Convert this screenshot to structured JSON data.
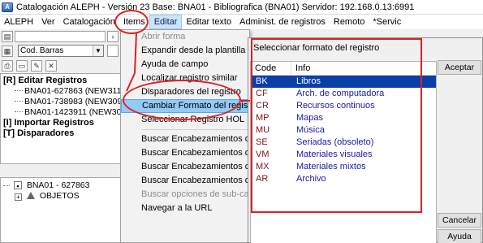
{
  "window": {
    "title": "Catalogación ALEPH - Versión 23  Base: BNA01 - Bibliografica (BNA01)  Servidor: 192.168.0.13:6991"
  },
  "menubar": {
    "items": [
      "ALEPH",
      "Ver",
      "Catalogación",
      "Items",
      "Editar",
      "Editar texto",
      "Administ. de registros",
      "Remoto",
      "*Servic"
    ]
  },
  "left_panel": {
    "search_combo_value": "Cod. Barras",
    "tree": {
      "edit_registros": "[R] Editar Registros",
      "records": [
        "BNA01-627863 (NEW311.MR",
        "BNA01-738983 (NEW309.MR",
        "BNA01-1423911 (NEW307.M"
      ],
      "importar": "[I] Importar Registros",
      "disparadores": "[T] Disparadores"
    },
    "record_tree": {
      "root": "BNA01 - 627863",
      "child": "OBJETOS"
    }
  },
  "edit_menu": {
    "items": [
      {
        "label": "Abrir forma",
        "disabled": true
      },
      {
        "label": "Expandir desde la plantilla",
        "disabled": false
      },
      {
        "label": "Ayuda de campo",
        "disabled": false
      },
      {
        "label": "Localizar registro similar",
        "disabled": false
      },
      {
        "label": "Disparadores del registro",
        "disabled": false
      },
      {
        "label": "Cambiar Formato del registro",
        "disabled": false,
        "selected": true
      },
      {
        "label": "Seleccionar Registro HOL",
        "disabled": false
      },
      {
        "separator": true
      },
      {
        "label": "Buscar Encabezamientos de Campo",
        "disabled": false
      },
      {
        "label": "Buscar Encabezamientos de Campo",
        "disabled": false
      },
      {
        "label": "Buscar Encabezamientos de Subca",
        "disabled": false
      },
      {
        "label": "Buscar Encabezamientos de Subca",
        "disabled": false
      },
      {
        "label": "Buscar opciones de sub-campo",
        "disabled": true
      },
      {
        "label": "Navegar a la URL",
        "disabled": false
      }
    ]
  },
  "dialog": {
    "title": "Seleccionar formato del registro",
    "columns": [
      "Code",
      "Info"
    ],
    "rows": [
      {
        "code": "BK",
        "info": "Libros",
        "selected": true
      },
      {
        "code": "CF",
        "info": "Arch. de computadora"
      },
      {
        "code": "CR",
        "info": "Recursos continuos"
      },
      {
        "code": "MP",
        "info": "Mapas"
      },
      {
        "code": "MU",
        "info": "Música"
      },
      {
        "code": "SE",
        "info": "Seriadas (obsoleto)"
      },
      {
        "code": "VM",
        "info": "Materiales visuales"
      },
      {
        "code": "MX",
        "info": "Materiales mixtos"
      },
      {
        "code": "AR",
        "info": "Archivo"
      }
    ],
    "buttons": {
      "accept": "Aceptar",
      "cancel": "Cancelar",
      "help": "Ayuda"
    }
  },
  "colors": {
    "annotation": "#e02020",
    "selection": "#0b3fa8",
    "menu_highlight": "#91c9f7"
  }
}
